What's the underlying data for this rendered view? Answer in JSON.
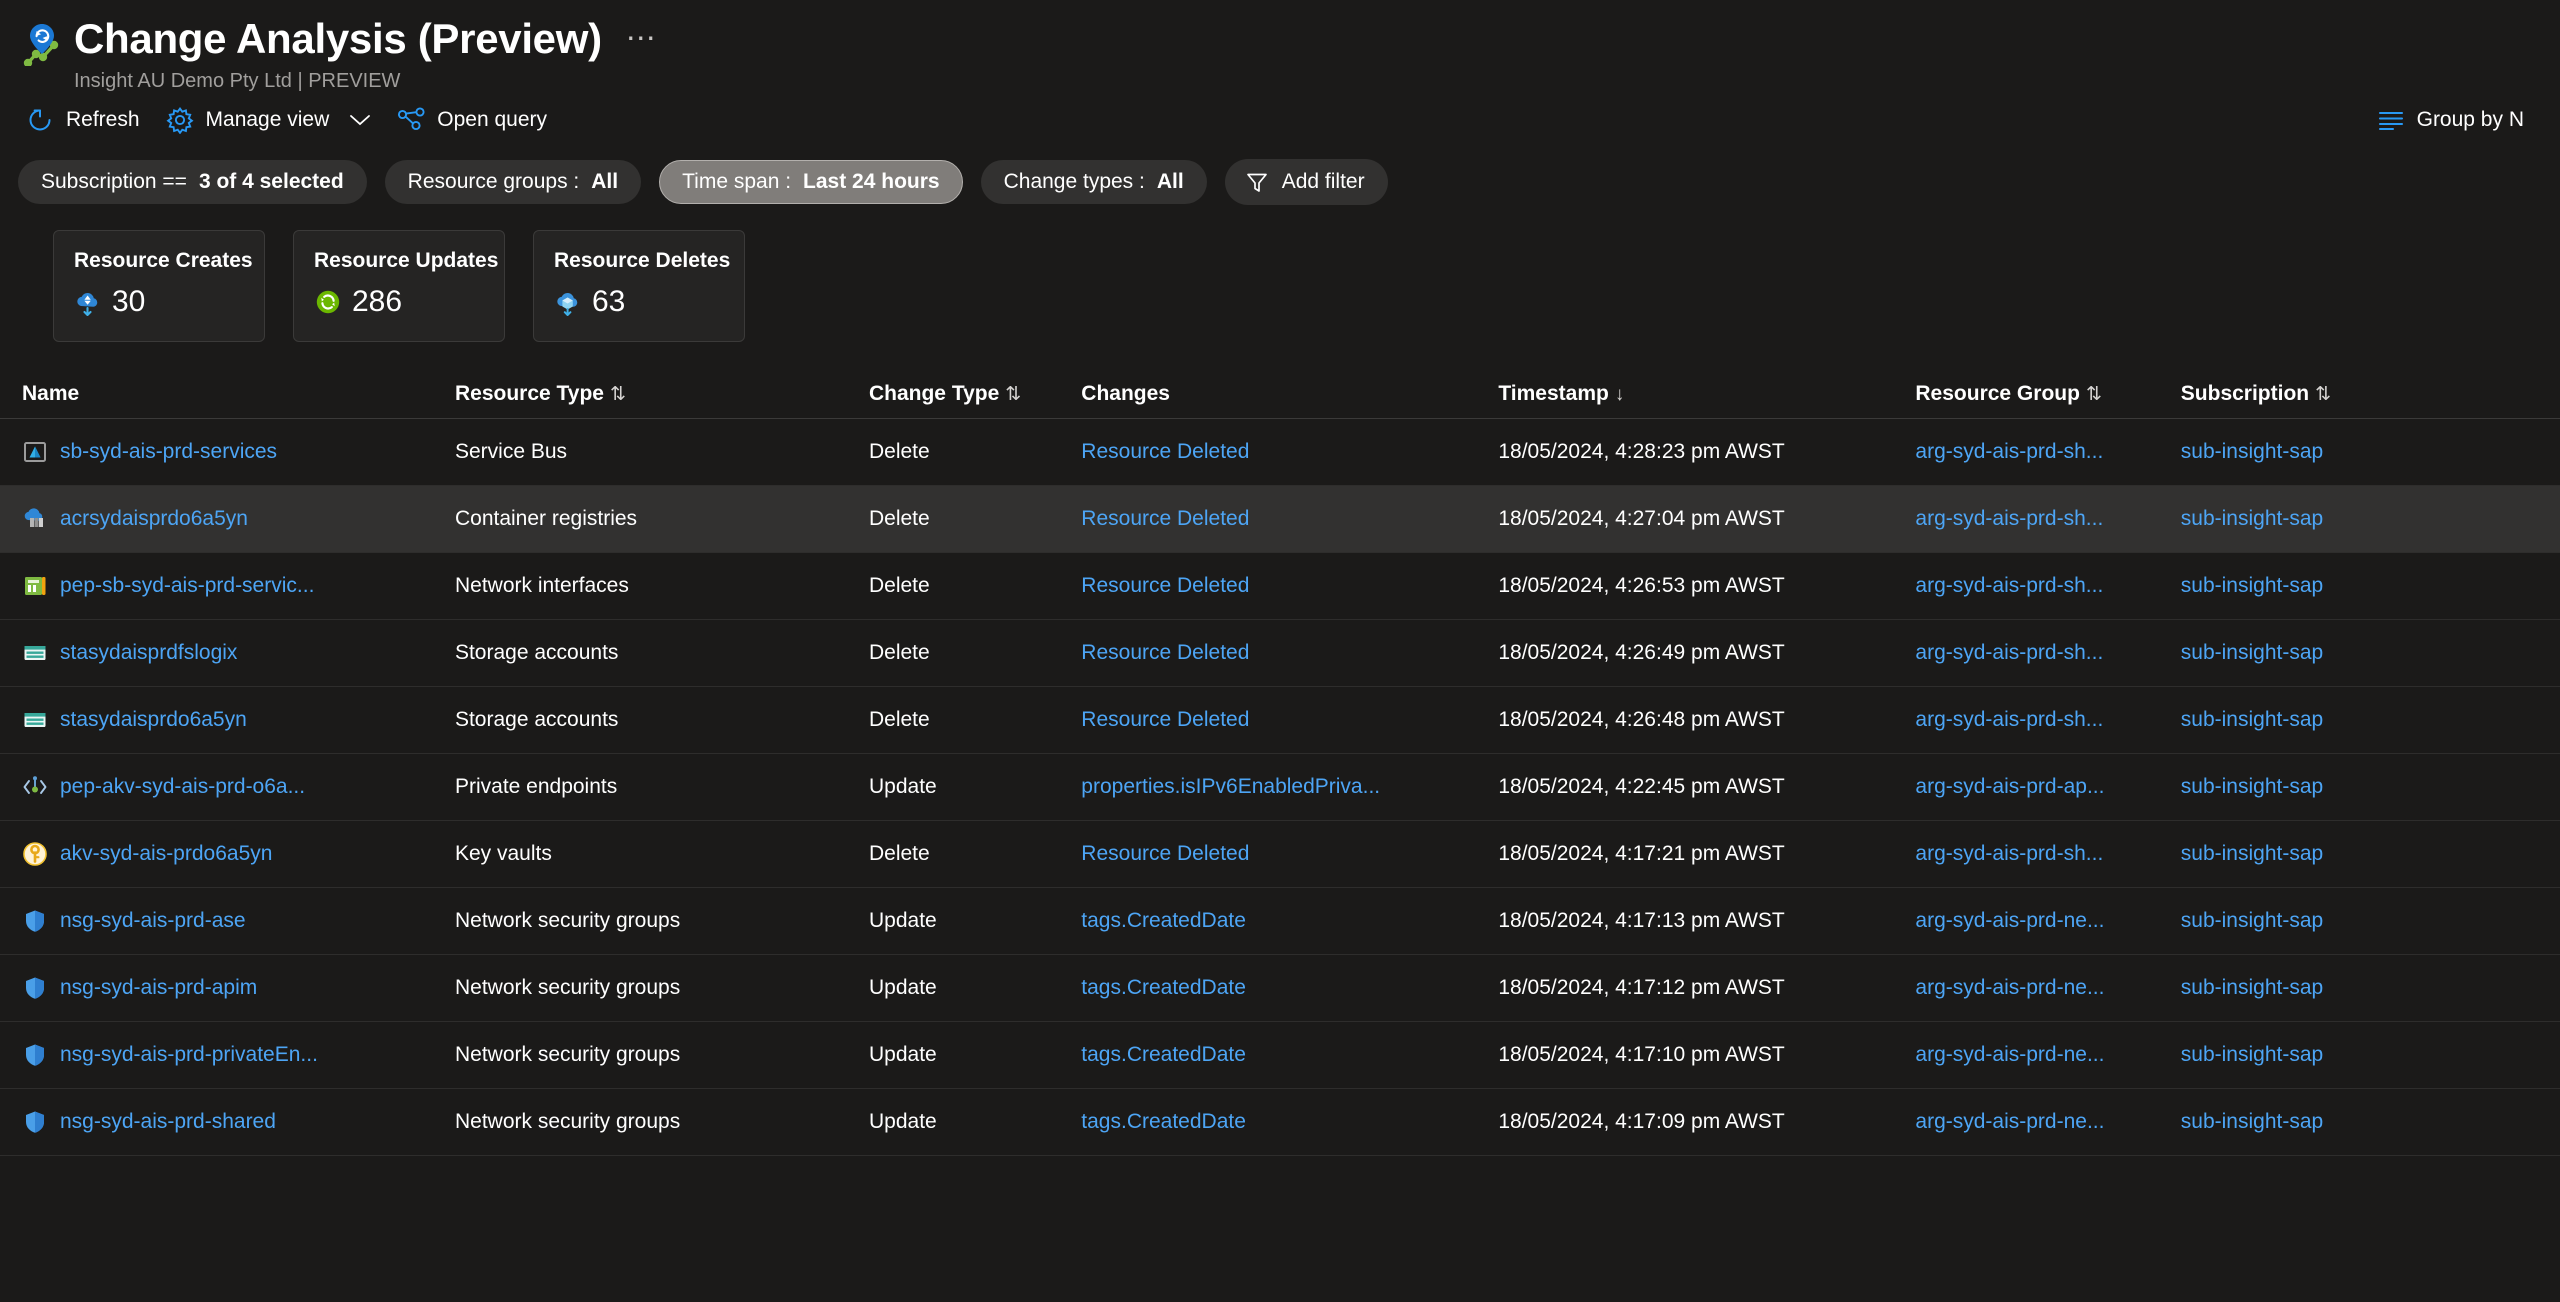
{
  "header": {
    "title": "Change Analysis (Preview)",
    "subtitle": "Insight AU Demo Pty Ltd | PREVIEW",
    "more_label": "⋯",
    "app_icon": "change-analysis-icon"
  },
  "commandbar": {
    "refresh": {
      "label": "Refresh",
      "icon": "refresh-icon"
    },
    "manage_view": {
      "label": "Manage view",
      "icon": "gear-icon",
      "chevron": "⌄"
    },
    "open_query": {
      "label": "Open query",
      "icon": "share-graph-icon"
    },
    "group_by": {
      "label": "Group by N",
      "icon": "group-lines-icon"
    }
  },
  "filters": [
    {
      "name": "subscription",
      "prefix": "Subscription == ",
      "value": "3 of 4 selected",
      "active": false,
      "icon": null
    },
    {
      "name": "resource-groups",
      "prefix": "Resource groups : ",
      "value": "All",
      "active": false,
      "icon": null
    },
    {
      "name": "time-span",
      "prefix": "Time span : ",
      "value": "Last 24 hours",
      "active": true,
      "icon": null
    },
    {
      "name": "change-types",
      "prefix": "Change types : ",
      "value": "All",
      "active": false,
      "icon": null
    },
    {
      "name": "add-filter",
      "prefix": "",
      "value": "Add filter",
      "active": false,
      "icon": "filter-funnel-icon"
    }
  ],
  "cards": [
    {
      "title": "Resource Creates",
      "value": "30",
      "icon": "cloud-create-icon",
      "color": "#3c91e6"
    },
    {
      "title": "Resource Updates",
      "value": "286",
      "icon": "update-refresh-icon",
      "color": "#6bb700"
    },
    {
      "title": "Resource Deletes",
      "value": "63",
      "icon": "cloud-delete-icon",
      "color": "#4aa7e0"
    }
  ],
  "table": {
    "columns": [
      {
        "label": "Name",
        "sort": ""
      },
      {
        "label": "Resource Type",
        "sort": "⇅"
      },
      {
        "label": "Change Type",
        "sort": "⇅"
      },
      {
        "label": "Changes",
        "sort": ""
      },
      {
        "label": "Timestamp",
        "sort": "↓"
      },
      {
        "label": "Resource Group",
        "sort": "⇅"
      },
      {
        "label": "Subscription",
        "sort": "⇅"
      }
    ],
    "rows": [
      {
        "icon": "service-bus-icon",
        "name": "sb-syd-ais-prd-services",
        "type": "Service Bus",
        "change_type": "Delete",
        "changes": "Resource Deleted",
        "timestamp": "18/05/2024, 4:28:23 pm AWST",
        "resource_group": "arg-syd-ais-prd-sh...",
        "subscription": "sub-insight-sap",
        "hovered": false
      },
      {
        "icon": "container-registry-icon",
        "name": "acrsydaisprdo6a5yn",
        "type": "Container registries",
        "change_type": "Delete",
        "changes": "Resource Deleted",
        "timestamp": "18/05/2024, 4:27:04 pm AWST",
        "resource_group": "arg-syd-ais-prd-sh...",
        "subscription": "sub-insight-sap",
        "hovered": true
      },
      {
        "icon": "network-interface-icon",
        "name": "pep-sb-syd-ais-prd-servic...",
        "type": "Network interfaces",
        "change_type": "Delete",
        "changes": "Resource Deleted",
        "timestamp": "18/05/2024, 4:26:53 pm AWST",
        "resource_group": "arg-syd-ais-prd-sh...",
        "subscription": "sub-insight-sap",
        "hovered": false
      },
      {
        "icon": "storage-account-icon",
        "name": "stasydaisprdfslogix",
        "type": "Storage accounts",
        "change_type": "Delete",
        "changes": "Resource Deleted",
        "timestamp": "18/05/2024, 4:26:49 pm AWST",
        "resource_group": "arg-syd-ais-prd-sh...",
        "subscription": "sub-insight-sap",
        "hovered": false
      },
      {
        "icon": "storage-account-icon",
        "name": "stasydaisprdo6a5yn",
        "type": "Storage accounts",
        "change_type": "Delete",
        "changes": "Resource Deleted",
        "timestamp": "18/05/2024, 4:26:48 pm AWST",
        "resource_group": "arg-syd-ais-prd-sh...",
        "subscription": "sub-insight-sap",
        "hovered": false
      },
      {
        "icon": "private-endpoint-icon",
        "name": "pep-akv-syd-ais-prd-o6a...",
        "type": "Private endpoints",
        "change_type": "Update",
        "changes": "properties.isIPv6EnabledPriva...",
        "timestamp": "18/05/2024, 4:22:45 pm AWST",
        "resource_group": "arg-syd-ais-prd-ap...",
        "subscription": "sub-insight-sap",
        "hovered": false
      },
      {
        "icon": "key-vault-icon",
        "name": "akv-syd-ais-prdo6a5yn",
        "type": "Key vaults",
        "change_type": "Delete",
        "changes": "Resource Deleted",
        "timestamp": "18/05/2024, 4:17:21 pm AWST",
        "resource_group": "arg-syd-ais-prd-sh...",
        "subscription": "sub-insight-sap",
        "hovered": false
      },
      {
        "icon": "network-security-group-icon",
        "name": "nsg-syd-ais-prd-ase",
        "type": "Network security groups",
        "change_type": "Update",
        "changes": "tags.CreatedDate",
        "timestamp": "18/05/2024, 4:17:13 pm AWST",
        "resource_group": "arg-syd-ais-prd-ne...",
        "subscription": "sub-insight-sap",
        "hovered": false
      },
      {
        "icon": "network-security-group-icon",
        "name": "nsg-syd-ais-prd-apim",
        "type": "Network security groups",
        "change_type": "Update",
        "changes": "tags.CreatedDate",
        "timestamp": "18/05/2024, 4:17:12 pm AWST",
        "resource_group": "arg-syd-ais-prd-ne...",
        "subscription": "sub-insight-sap",
        "hovered": false
      },
      {
        "icon": "network-security-group-icon",
        "name": "nsg-syd-ais-prd-privateEn...",
        "type": "Network security groups",
        "change_type": "Update",
        "changes": "tags.CreatedDate",
        "timestamp": "18/05/2024, 4:17:10 pm AWST",
        "resource_group": "arg-syd-ais-prd-ne...",
        "subscription": "sub-insight-sap",
        "hovered": false
      },
      {
        "icon": "network-security-group-icon",
        "name": "nsg-syd-ais-prd-shared",
        "type": "Network security groups",
        "change_type": "Update",
        "changes": "tags.CreatedDate",
        "timestamp": "18/05/2024, 4:17:09 pm AWST",
        "resource_group": "arg-syd-ais-prd-ne...",
        "subscription": "sub-insight-sap",
        "hovered": false
      }
    ]
  },
  "colors": {
    "background": "#1b1a19",
    "card_background": "#252423",
    "link": "#4da5f5",
    "accent_blue": "#2899f5",
    "pill_background": "#323130",
    "pill_active": "#807d7a",
    "row_hover": "#323130"
  }
}
